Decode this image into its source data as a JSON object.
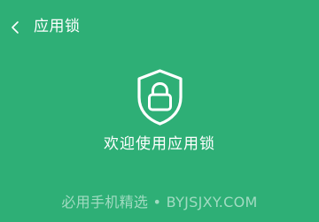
{
  "header": {
    "back_icon": "chevron-left-icon",
    "title": "应用锁"
  },
  "main": {
    "icon": "shield-lock-icon",
    "welcome_text": "欢迎使用应用锁"
  },
  "watermark": {
    "text": "必用手机精选 • BYJSJXY.COM"
  },
  "colors": {
    "background": "#2eaf76",
    "foreground": "#ffffff"
  }
}
